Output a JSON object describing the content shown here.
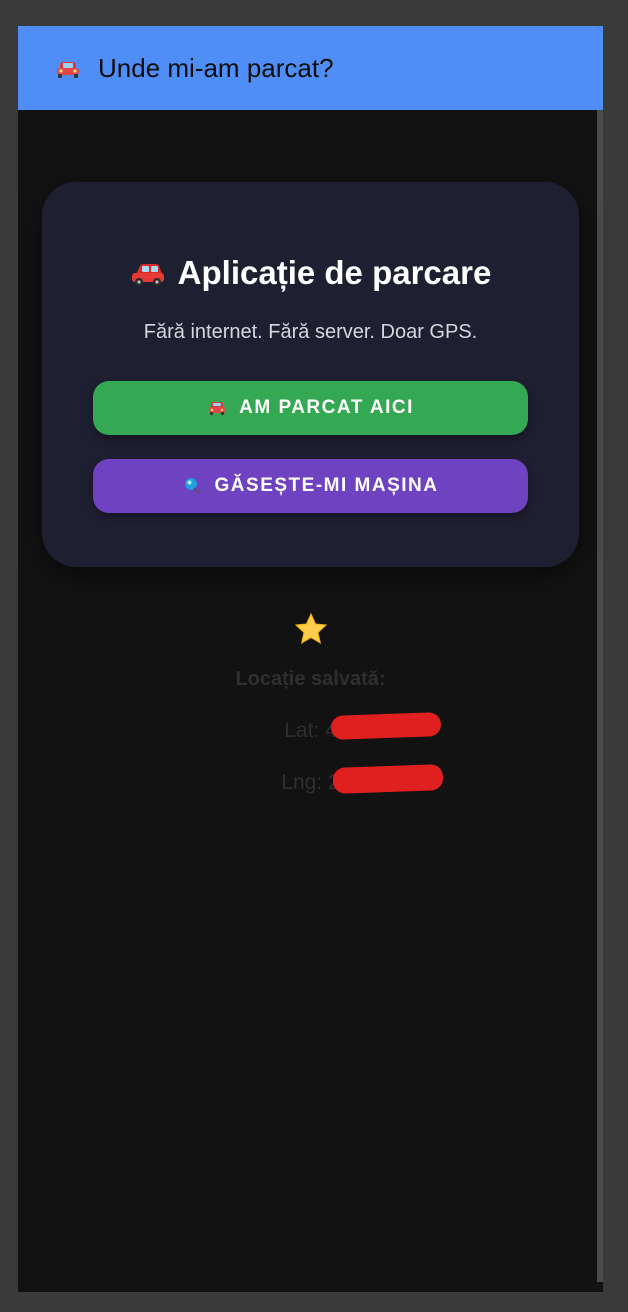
{
  "window": {
    "title": "Unde mi-am parcat?",
    "title_icon": "car-icon"
  },
  "card": {
    "title": "Aplicație de parcare",
    "title_icon": "red-car-icon",
    "subtitle": "Fără internet. Fără server. Doar GPS.",
    "park_button": {
      "label": "AM PARCAT AICI",
      "icon": "car-icon",
      "color": "#34a853"
    },
    "find_button": {
      "label": "GĂSEȘTE-MI MAȘINA",
      "icon": "magnifier-icon",
      "color": "#6f42c1"
    }
  },
  "saved_location": {
    "icon": "star-icon",
    "label": "Locație salvată:",
    "lat_label": "Lat: 4",
    "lng_label": "Lng: 2"
  },
  "colors": {
    "titlebar": "#4f8ef7",
    "background": "#121212",
    "card": "#1f1f32",
    "redaction": "#e0201f",
    "star": "#ffcc4d"
  }
}
